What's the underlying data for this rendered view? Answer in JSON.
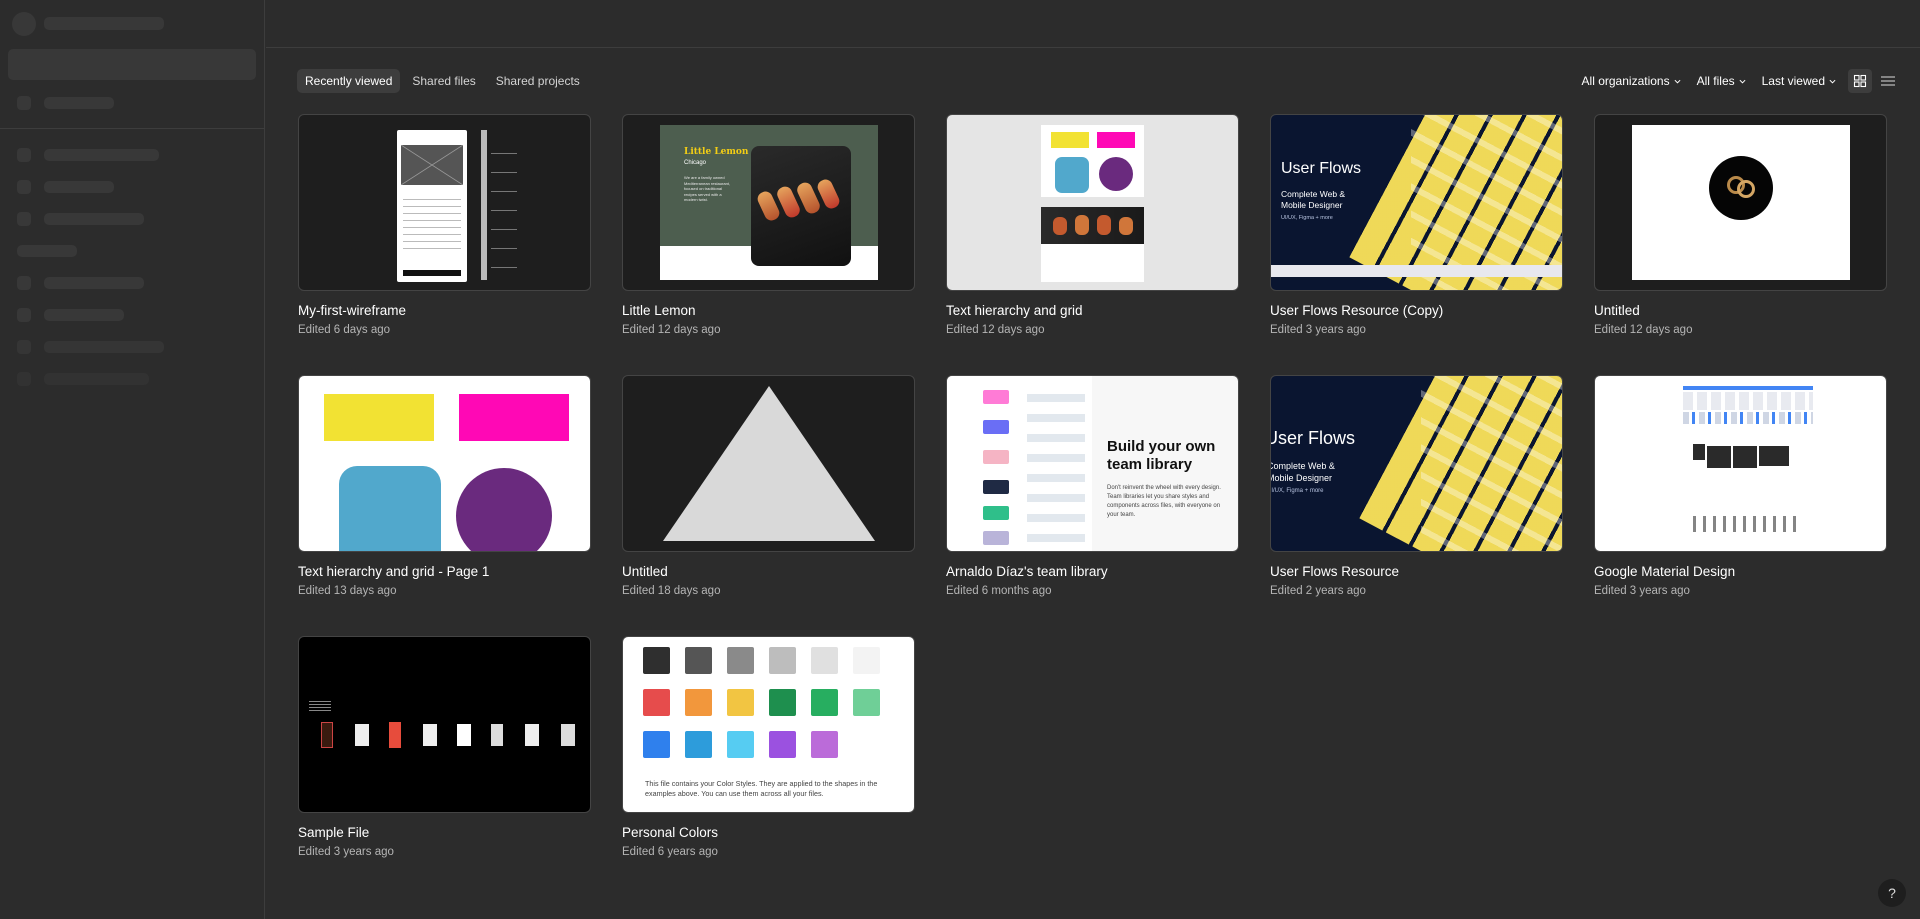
{
  "tabs": [
    {
      "label": "Recently viewed",
      "active": true
    },
    {
      "label": "Shared files",
      "active": false
    },
    {
      "label": "Shared projects",
      "active": false
    }
  ],
  "controls": {
    "organizations": "All organizations",
    "files": "All files",
    "sort": "Last viewed"
  },
  "files": [
    {
      "title": "My-first-wireframe",
      "meta": "Edited 6 days ago"
    },
    {
      "title": "Little Lemon",
      "meta": "Edited 12 days ago"
    },
    {
      "title": "Text hierarchy and grid",
      "meta": "Edited 12 days ago"
    },
    {
      "title": "User Flows Resource (Copy)",
      "meta": "Edited 3 years ago"
    },
    {
      "title": "Untitled",
      "meta": "Edited 12 days ago"
    },
    {
      "title": "Text hierarchy and grid - Page 1",
      "meta": "Edited 13 days ago"
    },
    {
      "title": "Untitled",
      "meta": "Edited 18 days ago"
    },
    {
      "title": "Arnaldo Díaz's team library",
      "meta": "Edited 6 months ago"
    },
    {
      "title": "User Flows Resource",
      "meta": "Edited 2 years ago"
    },
    {
      "title": "Google Material Design",
      "meta": "Edited 3 years ago"
    },
    {
      "title": "Sample File",
      "meta": "Edited 3 years ago"
    },
    {
      "title": "Personal Colors",
      "meta": "Edited 6 years ago"
    }
  ],
  "thumb_text": {
    "little_lemon_title": "Little Lemon",
    "little_lemon_city": "Chicago",
    "little_lemon_body": "We are a family owned Mediterranean restaurant, focused on traditional recipes served with a modern twist.",
    "user_flows_title": "User Flows",
    "user_flows_sub": "Complete Web & Mobile Designer",
    "user_flows_tag": "UI/UX, Figma + more",
    "library_title": "Build your own team library",
    "library_body": "Don't reinvent the wheel with every design. Team libraries let you share styles and components across files, with everyone on your team.",
    "colors_note": "This file contains your Color Styles. They are applied to the shapes in the examples above. You can use them across all your files."
  },
  "colors": {
    "background": "#2c2c2c",
    "yellow": "#f2e233",
    "magenta": "#ff08b5",
    "blue": "#51a8cc",
    "purple": "#6a2a7e",
    "lemon_green": "#4d5e4f",
    "navy": "#0a1530"
  },
  "palette": [
    "#2f2f2f",
    "#555555",
    "#8a8a8a",
    "#bdbdbd",
    "#e0e0e0",
    "#f3f3f3",
    "#e64c4c",
    "#f2973c",
    "#f2c542",
    "#1e8f4e",
    "#27ae60",
    "#6fcf97",
    "#2f80ed",
    "#2d9cdb",
    "#56ccf2",
    "#9b51e0",
    "#bb6bd9"
  ],
  "icons": [
    "chevron-down-icon",
    "grid-view-icon",
    "list-view-icon",
    "help-icon"
  ],
  "help_label": "?"
}
